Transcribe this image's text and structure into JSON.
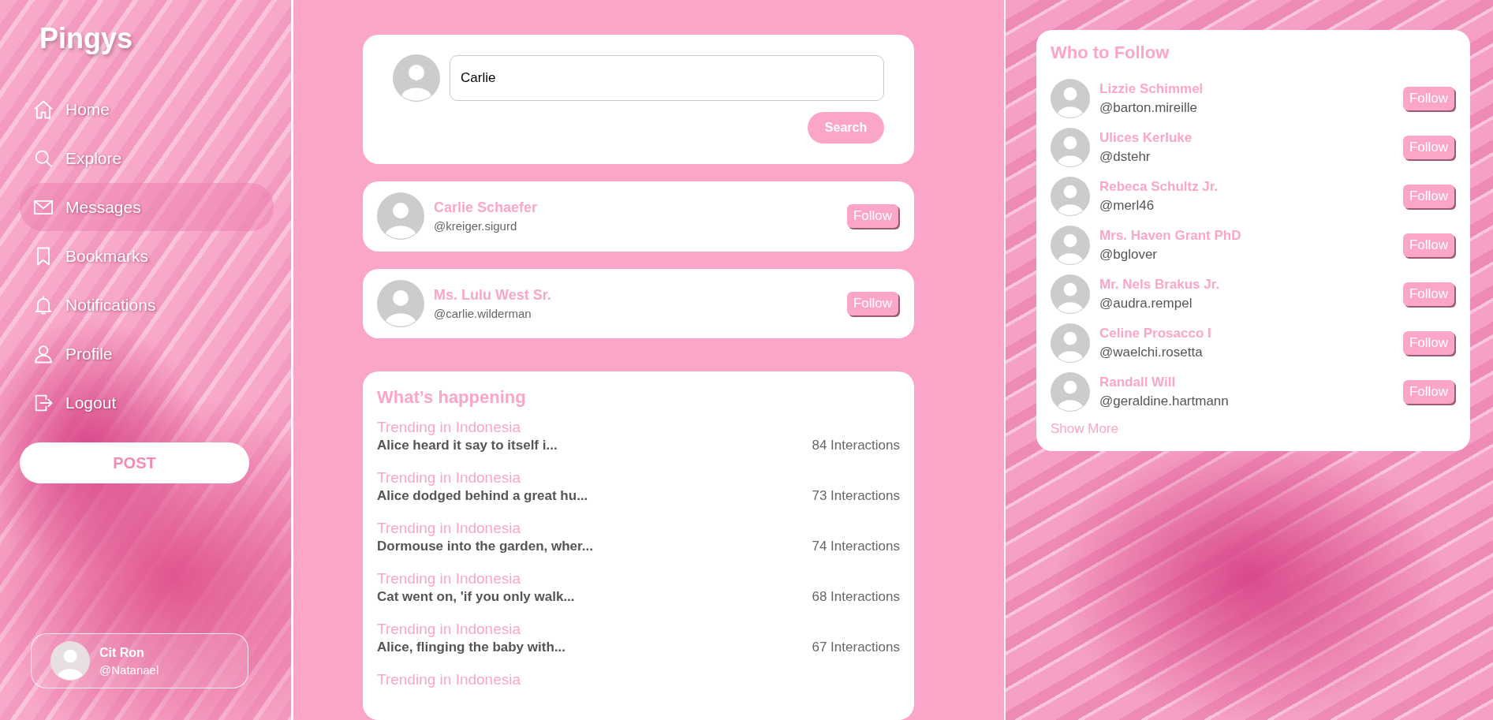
{
  "brand": "Pingys",
  "nav": [
    {
      "label": "Home",
      "kind": "home",
      "selected": false
    },
    {
      "label": "Explore",
      "kind": "search",
      "selected": false
    },
    {
      "label": "Messages",
      "kind": "mail",
      "selected": true
    },
    {
      "label": "Bookmarks",
      "kind": "bookmark",
      "selected": false
    },
    {
      "label": "Notifications",
      "kind": "bell",
      "selected": false
    },
    {
      "label": "Profile",
      "kind": "user",
      "selected": false
    },
    {
      "label": "Logout",
      "kind": "logout",
      "selected": false
    }
  ],
  "post_button": "POST",
  "current_user": {
    "name": "Cit Ron",
    "handle": "@Natanael"
  },
  "search": {
    "value": "Carlie",
    "button": "Search"
  },
  "results": [
    {
      "name": "Carlie Schaefer",
      "handle": "@kreiger.sigurd",
      "button": "Follow"
    },
    {
      "name": "Ms. Lulu West Sr.",
      "handle": "@carlie.wilderman",
      "button": "Follow"
    }
  ],
  "trending": {
    "title": "What’s happening",
    "items": [
      {
        "category": "Trending in Indonesia",
        "snippet": "Alice heard it say to itself i...",
        "count": "84 Interactions"
      },
      {
        "category": "Trending in Indonesia",
        "snippet": "Alice dodged behind a great hu...",
        "count": "73 Interactions"
      },
      {
        "category": "Trending in Indonesia",
        "snippet": "Dormouse into the garden, wher...",
        "count": "74 Interactions"
      },
      {
        "category": "Trending in Indonesia",
        "snippet": "Cat went on, 'if you only walk...",
        "count": "68 Interactions"
      },
      {
        "category": "Trending in Indonesia",
        "snippet": "Alice, flinging the baby with...",
        "count": "67 Interactions"
      },
      {
        "category": "Trending in Indonesia"
      }
    ]
  },
  "who_to_follow": {
    "title": "Who to Follow",
    "users": [
      {
        "name": "Lizzie Schimmel",
        "handle": "@barton.mireille",
        "button": "Follow"
      },
      {
        "name": "Ulices Kerluke",
        "handle": "@dstehr",
        "button": "Follow"
      },
      {
        "name": "Rebeca Schultz Jr.",
        "handle": "@merl46",
        "button": "Follow"
      },
      {
        "name": "Mrs. Haven Grant PhD",
        "handle": "@bglover",
        "button": "Follow"
      },
      {
        "name": "Mr. Nels Brakus Jr.",
        "handle": "@audra.rempel",
        "button": "Follow"
      },
      {
        "name": "Celine Prosacco I",
        "handle": "@waelchi.rosetta",
        "button": "Follow"
      },
      {
        "name": "Randall Will",
        "handle": "@geraldine.hartmann",
        "button": "Follow"
      }
    ],
    "show_more": "Show More"
  }
}
